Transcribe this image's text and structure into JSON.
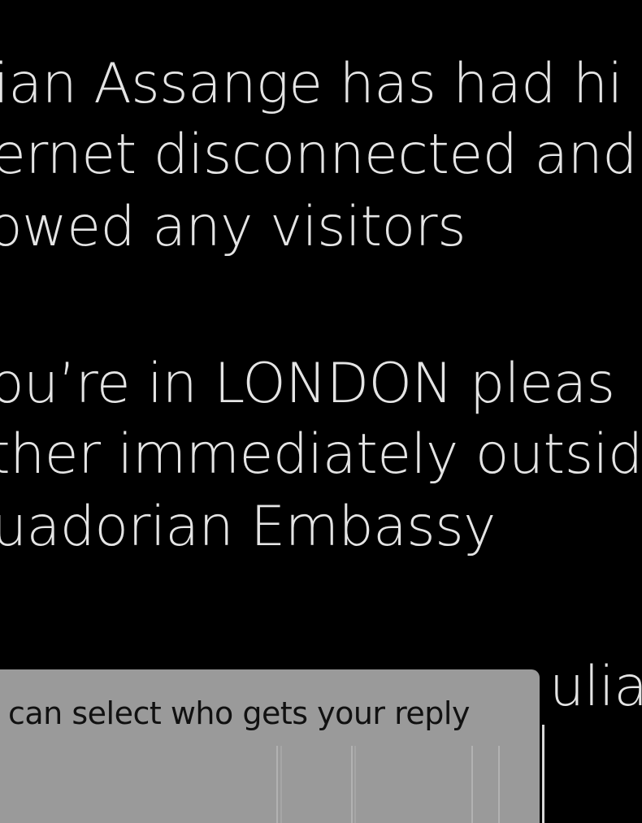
{
  "post": {
    "lines": [
      "ian Assange has had hi",
      "ernet disconnected and",
      "owed any visitors",
      "ou’re in LONDON pleas",
      "ther immediately outsid",
      "uadorian Embassy",
      "ulia"
    ]
  },
  "tooltip": {
    "text": "can select who gets your reply"
  }
}
